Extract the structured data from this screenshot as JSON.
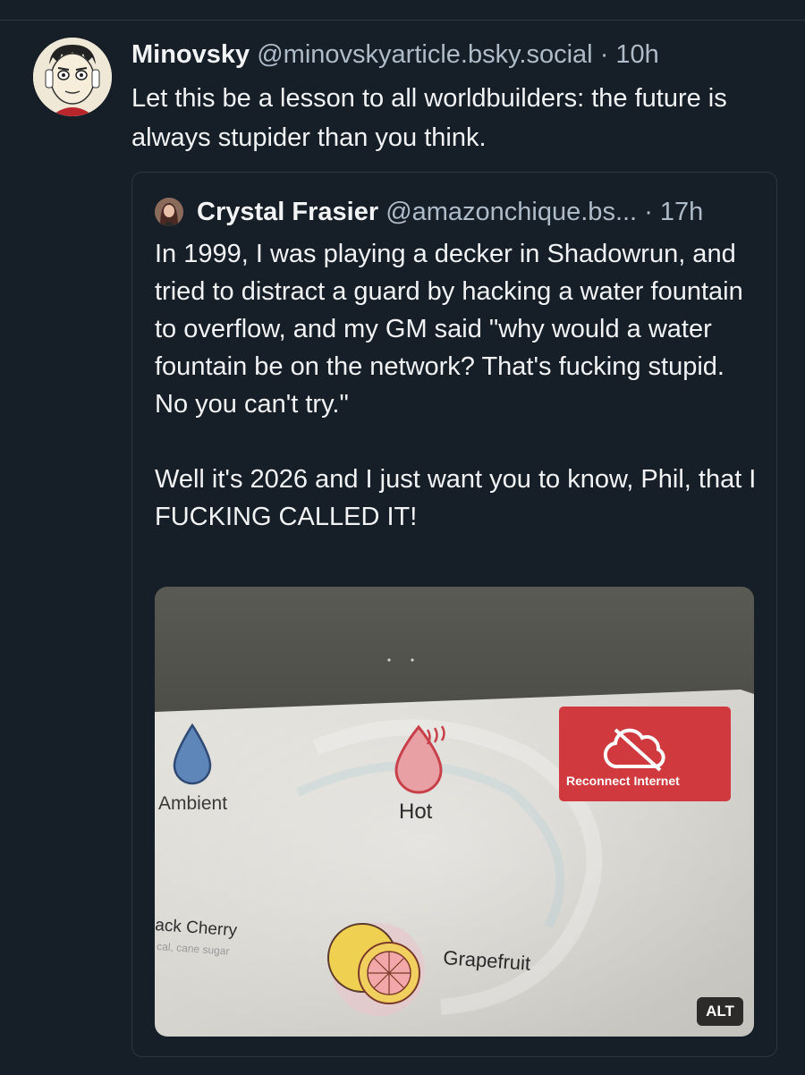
{
  "post": {
    "author": {
      "display_name": "Minovsky",
      "handle": "@minovskyarticle.bsky.social",
      "avatar_icon": "manga-face-avatar-icon"
    },
    "separator": "·",
    "time": "10h",
    "text": "Let this be a lesson to all worldbuilders: the future is always stupider than you think."
  },
  "quote": {
    "author": {
      "display_name": "Crystal Frasier",
      "handle": "@amazonchique.bs...",
      "avatar_icon": "portrait-avatar-icon"
    },
    "separator": "·",
    "time": "17h",
    "text": "In 1999, I was playing a decker in Shadowrun, and tried to distract a guard by hacking a water fountain to overflow, and my GM said \"why would a water fountain be on the network? That's fucking stupid. No you can't try.\"\n\nWell it's 2026 and I just want you to know, Phil, that I FUCKING CALLED IT!",
    "image": {
      "alt_badge": "ALT",
      "screen": {
        "ambient_label": "Ambient",
        "hot_label": "Hot",
        "reconnect_label": "Reconnect Internet",
        "black_cherry_label": "ack Cherry",
        "black_cherry_sub": "cal, cane sugar",
        "grapefruit_label": "Grapefruit"
      }
    }
  },
  "colors": {
    "background": "#161e27",
    "text": "#f1f3f5",
    "muted": "#aebbc9",
    "border": "#2c3642",
    "reconnect_red": "#d03a3f"
  }
}
